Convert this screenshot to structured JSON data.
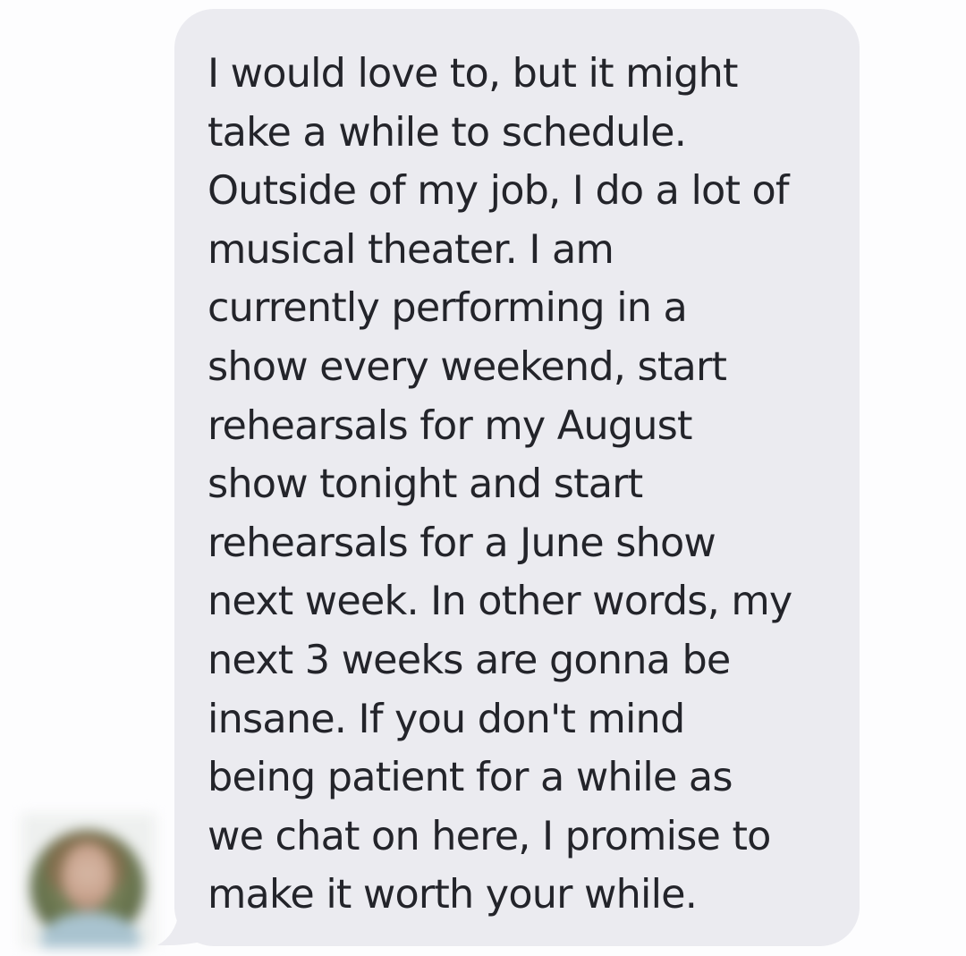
{
  "conversation": {
    "message": {
      "text": "I would love to, but it might\ntake a while to schedule.\nOutside of my job, I do a lot of\nmusical theater. I am\ncurrently performing in a\nshow every weekend, start\nrehearsals for my August\nshow tonight and start\nrehearsals for a June show\nnext week. In other words, my\nnext 3 weeks are gonna be\ninsane. If you don't mind\nbeing patient for a while as\nwe chat on here, I promise to\nmake it worth your while."
    }
  },
  "colors": {
    "background": "#fdfdfe",
    "bubble": "#ebebf0",
    "text": "#23242a"
  },
  "icons": {
    "avatar": "blurred-profile-photo"
  }
}
